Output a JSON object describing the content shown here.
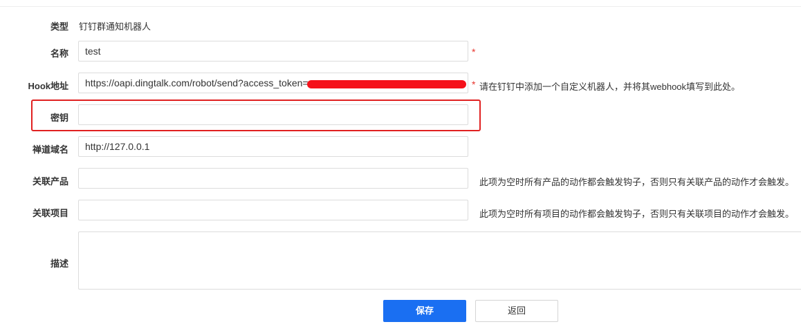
{
  "form": {
    "type": {
      "label": "类型",
      "value": "钉钉群通知机器人"
    },
    "name": {
      "label": "名称",
      "value": "test",
      "required_mark": "*"
    },
    "hook": {
      "label": "Hook地址",
      "value": "https://oapi.dingtalk.com/robot/send?access_token=",
      "required_mark": "*",
      "hint": "请在钉钉中添加一个自定义机器人，并将其webhook填写到此处。"
    },
    "secret": {
      "label": "密钥",
      "value": ""
    },
    "domain": {
      "label": "禅道域名",
      "value": "http://127.0.0.1"
    },
    "products": {
      "label": "关联产品",
      "value": "",
      "hint": "此项为空时所有产品的动作都会触发钩子，否则只有关联产品的动作才会触发。"
    },
    "projects": {
      "label": "关联项目",
      "value": "",
      "hint": "此项为空时所有项目的动作都会触发钩子，否则只有关联项目的动作才会触发。"
    },
    "description": {
      "label": "描述",
      "value": ""
    }
  },
  "actions": {
    "save_label": "保存",
    "back_label": "返回"
  },
  "colors": {
    "primary": "#1a6ff2",
    "required": "#e8352e",
    "highlight": "#e02020",
    "redaction": "#f5111a"
  }
}
